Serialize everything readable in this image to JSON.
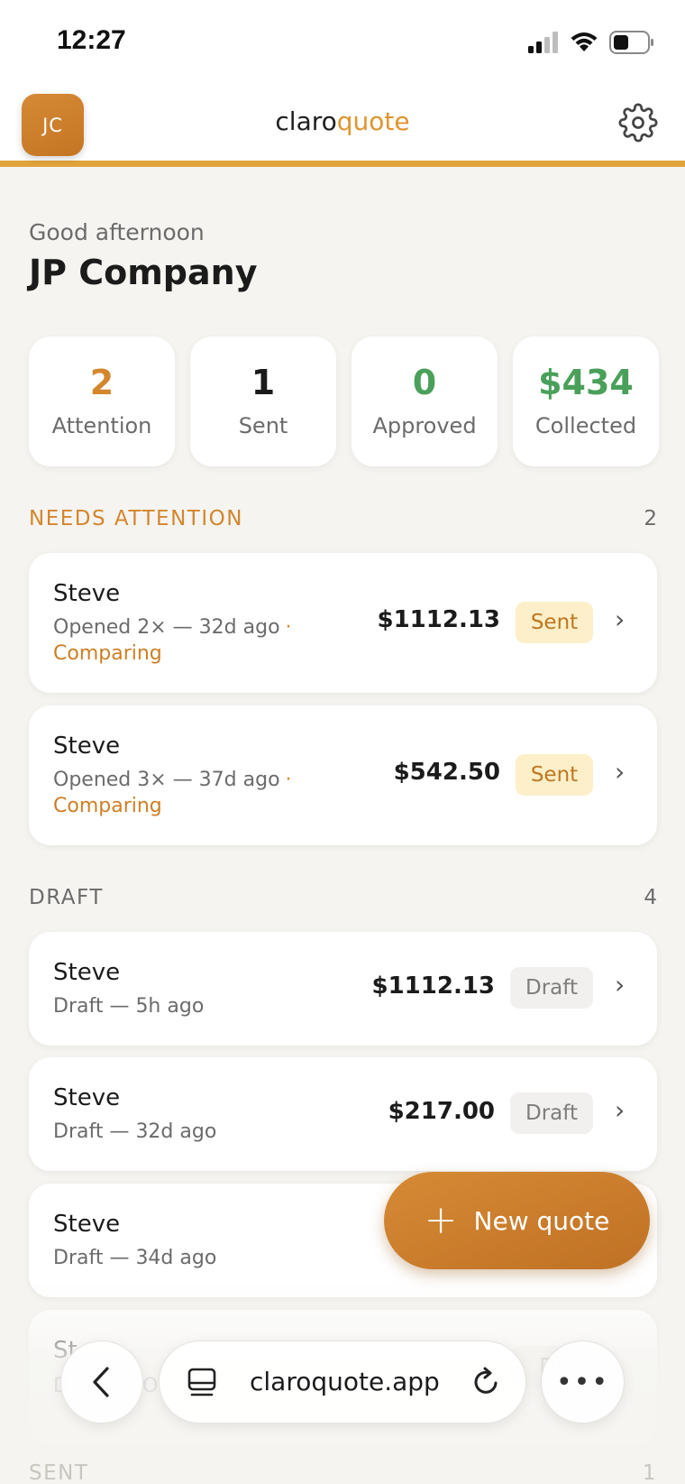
{
  "status_bar": {
    "time": "12:27"
  },
  "header": {
    "avatar_initials": "JC",
    "brand_part1": "claro",
    "brand_part2": "quote",
    "brand_color": "#e0952f",
    "accent_line_color": "#e0a33a"
  },
  "greeting": {
    "salutation": "Good afternoon",
    "company": "JP Company"
  },
  "stats": [
    {
      "value": "2",
      "label": "Attention",
      "color": "#d4862c"
    },
    {
      "value": "1",
      "label": "Sent",
      "color": "#1b1b1b"
    },
    {
      "value": "0",
      "label": "Approved",
      "color": "#4aa05a"
    },
    {
      "value": "$434",
      "label": "Collected",
      "color": "#4aa05a"
    }
  ],
  "sections": {
    "needs_attention": {
      "title": "NEEDS ATTENTION",
      "count": "2",
      "title_color": "#d4862c",
      "items": [
        {
          "name": "Steve",
          "meta": "Opened 2× — 32d ago",
          "dot": "·",
          "tag": "Comparing",
          "amount": "$1112.13",
          "badge": "Sent"
        },
        {
          "name": "Steve",
          "meta": "Opened 3× — 37d ago",
          "dot": "·",
          "tag": "Comparing",
          "amount": "$542.50",
          "badge": "Sent"
        }
      ]
    },
    "draft": {
      "title": "DRAFT",
      "count": "4",
      "items": [
        {
          "name": "Steve",
          "meta": "Draft — 5h ago",
          "amount": "$1112.13",
          "badge": "Draft"
        },
        {
          "name": "Steve",
          "meta": "Draft — 32d ago",
          "amount": "$217.00",
          "badge": "Draft"
        },
        {
          "name": "Steve",
          "meta": "Draft — 34d ago"
        },
        {
          "name": "St",
          "meta": "D",
          "meta_after": "O",
          "badge_partial": "Dr"
        }
      ]
    },
    "sent": {
      "title": "SENT",
      "count": "1"
    }
  },
  "fab": {
    "label": "New quote",
    "icon": "plus-icon"
  },
  "browser": {
    "url": "claroquote.app"
  }
}
